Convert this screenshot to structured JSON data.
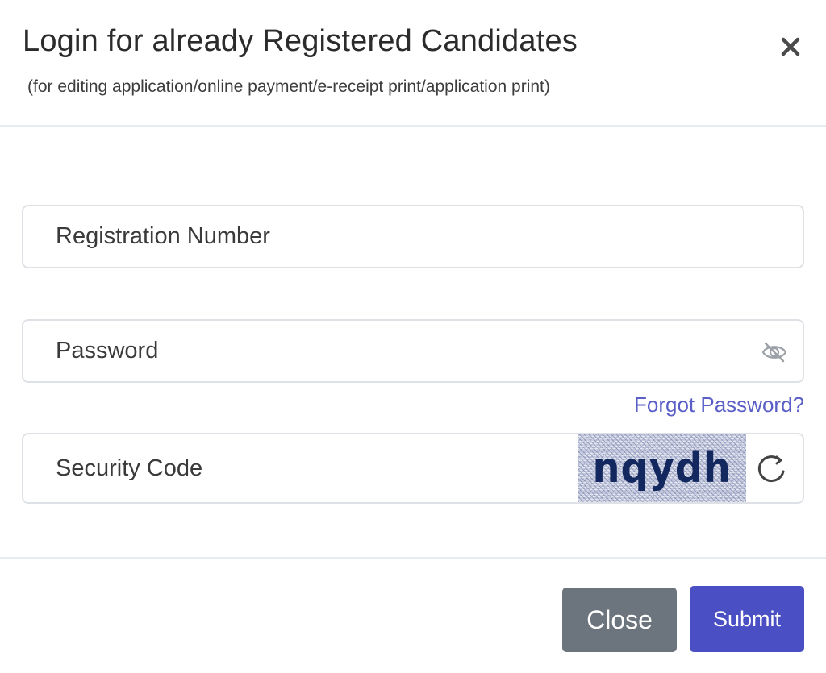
{
  "header": {
    "title": "Login for already Registered Candidates",
    "subtitle": "(for editing application/online payment/e-receipt print/application print)",
    "close_icon": "close-icon"
  },
  "form": {
    "registration": {
      "placeholder": "Registration Number",
      "value": ""
    },
    "password": {
      "placeholder": "Password",
      "value": "",
      "toggle_icon": "eye-off-icon"
    },
    "forgot_password": "Forgot Password?",
    "security_code": {
      "placeholder": "Security Code",
      "value": "",
      "captcha": "nqydh",
      "refresh_icon": "refresh-icon"
    }
  },
  "footer": {
    "close_label": "Close",
    "submit_label": "Submit"
  },
  "colors": {
    "link": "#5a5fc7",
    "close_button": "#6c757d",
    "submit_button": "#4a4fc4",
    "captcha_text": "#13285e"
  }
}
